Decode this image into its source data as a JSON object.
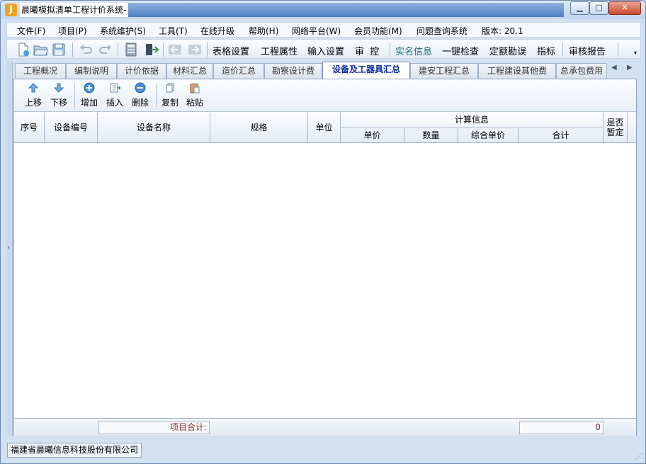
{
  "window": {
    "title": "晨曦模拟清单工程计价系统-",
    "app_icon_letter": "J",
    "min_glyph": "▁",
    "max_glyph": "□",
    "close_glyph": "✕"
  },
  "menu": [
    "文件(F)",
    "项目(P)",
    "系统维护(S)",
    "工具(T)",
    "在线升级",
    "帮助(H)",
    "网络平台(W)",
    "会员功能(M)",
    "问题查询系统",
    "版本: 20.1"
  ],
  "toolbar": {
    "icons": [
      "new-file-icon",
      "open-folder-icon",
      "save-disk-icon",
      "undo-icon",
      "redo-icon",
      "calculator-icon",
      "exit-door-icon",
      "back-arrow-icon",
      "forward-arrow-icon"
    ],
    "text_buttons": [
      {
        "label": "表格设置",
        "style": "blue"
      },
      {
        "label": "工程属性",
        "style": "blue"
      },
      {
        "label": "输入设置",
        "style": "blue"
      },
      {
        "label": "审  控",
        "style": "blue"
      },
      {
        "label": "实名信息",
        "style": "teal"
      },
      {
        "label": "一键检查",
        "style": "blue"
      },
      {
        "label": "定额勘误",
        "style": "blue"
      },
      {
        "label": "指标",
        "style": "blue"
      },
      {
        "label": "审核报告",
        "style": "blue"
      }
    ]
  },
  "tabs": [
    {
      "label": "工程概况",
      "active": false
    },
    {
      "label": "编制说明",
      "active": false
    },
    {
      "label": "计价依据",
      "active": false
    },
    {
      "label": "材料汇总",
      "active": false
    },
    {
      "label": "造价汇总",
      "active": false
    },
    {
      "label": "勘察设计费",
      "active": false
    },
    {
      "label": "设备及工器具汇总",
      "active": true
    },
    {
      "label": "建安工程汇总",
      "active": false
    },
    {
      "label": "工程建设其他费",
      "active": false
    },
    {
      "label": "总承包费用",
      "active": false
    }
  ],
  "sub_toolbar": [
    {
      "label": "上移",
      "icon": "move-up-icon"
    },
    {
      "label": "下移",
      "icon": "move-down-icon"
    },
    {
      "label": "增加",
      "icon": "add-icon"
    },
    {
      "label": "插入",
      "icon": "insert-icon"
    },
    {
      "label": "删除",
      "icon": "delete-icon"
    },
    {
      "label": "复制",
      "icon": "copy-icon"
    },
    {
      "label": "粘贴",
      "icon": "paste-icon"
    }
  ],
  "table": {
    "columns": {
      "index": "序号",
      "code": "设备编号",
      "name": "设备名称",
      "spec": "规格",
      "unit": "单位",
      "calc_group": "计算信息",
      "unit_price": "单价",
      "quantity": "数量",
      "comp_price": "综合单价",
      "total": "合计",
      "provisional": "是否\n暂定"
    },
    "rows": [],
    "footer": {
      "label": "项目合计:",
      "total": "0"
    }
  },
  "status": {
    "company": "福建省晨曦信息科技股份有限公司"
  }
}
